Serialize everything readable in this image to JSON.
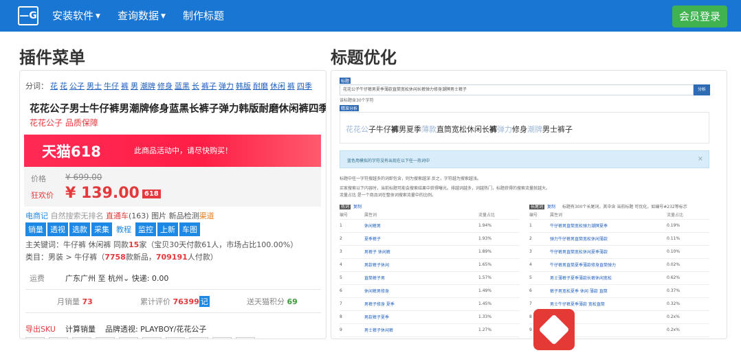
{
  "topbar": {
    "logo": "—G",
    "nav": [
      {
        "label": "安装软件",
        "caret": true
      },
      {
        "label": "查询数据",
        "caret": true
      },
      {
        "label": "制作标题",
        "caret": false
      }
    ],
    "member_button": "会员登录"
  },
  "left_section": {
    "title": "插件菜单",
    "tags_label": "分词：",
    "tags": [
      "花",
      "花",
      "公子",
      "男士",
      "牛仔",
      "裤",
      "男",
      "潮牌",
      "修身",
      "蓝黑",
      "长",
      "裤子",
      "弹力",
      "韩版",
      "耐磨",
      "休闲",
      "裤",
      "四季"
    ],
    "product_title": "花花公子男士牛仔裤男潮牌修身蓝黑长裤子弹力韩版耐磨休闲裤四季",
    "product_sub": "花花公子 品质保障",
    "banner": {
      "logo": "天猫618",
      "text": "此商品活动中，请尽快购买！"
    },
    "price": {
      "label_orig": "价格",
      "orig": "¥ 699.00",
      "label_sale": "狂欢价",
      "sale": "¥ 139.00",
      "badge": "618"
    },
    "line1": {
      "shop": "电商记",
      "text1": "自然搜索无排名",
      "ztc": "直通车",
      "ztc_count": "(163)",
      "pic": "图片",
      "detect": "新品检测",
      "channel": "渠道"
    },
    "buttons": [
      "销量",
      "透视",
      "选款",
      "采集",
      "教程",
      "监控",
      "上新",
      "车图"
    ],
    "keywords_line": {
      "label": "主关键词：",
      "kw": "牛仔裤 休闲裤",
      "same_label": "同款",
      "same_count": "15",
      "same_unit": "家",
      "detail": "（宝贝30天付款61人，市场占比100.00%）"
    },
    "category_line": {
      "label": "类目：",
      "path": "男装 > 牛仔裤",
      "new_count": "7758",
      "new_label": "款新品，",
      "buyers": "709191",
      "buyers_label": "人付款）"
    },
    "shipping": {
      "label": "运费",
      "from": "广东广州",
      "to_word": "至",
      "to": "杭州",
      "express": "快递: 0.00"
    },
    "stats": [
      {
        "label": "月销量",
        "value": "73"
      },
      {
        "label": "累计评价",
        "value": "76399",
        "tag": "记"
      },
      {
        "label": "送天猫积分",
        "value": "69"
      }
    ],
    "footer": [
      "导出SKU",
      "计算销量",
      "品牌透视: PLAYBOY/花花公子"
    ]
  },
  "right_section": {
    "title": "标题优化",
    "tag_title": "标题",
    "input_value": "花花公子牛仔裤男夏季薄款直筒宽松休闲长裤弹力修身潮牌男士裤子",
    "analyze_button": "分析",
    "char_count_note": "该标题含30个字符",
    "tag_optimized": "精准分析",
    "optimized": [
      {
        "t": "花花公",
        "gray": true
      },
      {
        "t": "子牛仔",
        "gray": false
      },
      {
        "t": "裤",
        "gray": false,
        "bold": true
      },
      {
        "t": "男夏季",
        "gray": false
      },
      {
        "t": "薄款",
        "gray": true
      },
      {
        "t": "直筒宽松休闲长",
        "gray": false
      },
      {
        "t": "裤",
        "gray": false,
        "bold": true
      },
      {
        "t": "弹力",
        "gray": true
      },
      {
        "t": "修身",
        "gray": false
      },
      {
        "t": "潮牌",
        "gray": true
      },
      {
        "t": "男士裤子",
        "gray": false
      }
    ],
    "alert": "蓝色用模拟的字符没有出现在以下任一热词中",
    "notes": [
      "标题中任一字符搜越多的词即包含，则为搜索越深 反之，字符越为搜索越浅。",
      "买家搜索以下内容时，当前标题可能会搜索结果中获得曝光。排越词越多，词越热门，标题获得的搜索流量就越大。",
      "流量占比 是一个商品词在整体词搜索流量中的比例。"
    ],
    "left_table": {
      "label": "热词",
      "copy": "复制",
      "headers": [
        "编号",
        "属性词",
        "流量占比"
      ],
      "rows": [
        [
          "1",
          "休闲裤男",
          "1.94%"
        ],
        [
          "2",
          "夏季裤子",
          "1.93%"
        ],
        [
          "3",
          "男裤子 休闲裤",
          "1.89%"
        ],
        [
          "4",
          "男款裤子休闲",
          "1.65%"
        ],
        [
          "5",
          "直筒裤子男",
          "1.57%"
        ],
        [
          "6",
          "休闲裤男修身",
          "1.49%"
        ],
        [
          "7",
          "男裤子修身 夏季",
          "1.45%"
        ],
        [
          "8",
          "男款裤子夏季",
          "1.33%"
        ],
        [
          "9",
          "男士裤子休闲裤",
          "1.27%"
        ]
      ]
    },
    "right_table": {
      "label": "长尾词",
      "copy": "复制",
      "note": "标题有300个长尾词，其中含 当前标题 可优化，如编号#232等标示",
      "headers": [
        "编号",
        "属性词",
        "流量占比"
      ],
      "rows": [
        [
          "1",
          "牛仔裤男直筒宽松弹力潮牌夏季",
          "0.19%"
        ],
        [
          "2",
          "弹力牛仔裤男直筒宽松休闲薄款",
          "0.11%"
        ],
        [
          "3",
          "牛仔裤男直筒宽松休闲夏季薄款",
          "0.10%"
        ],
        [
          "4",
          "牛仔裤男直筒夏季薄款修身直筒弹力",
          "0.02%"
        ],
        [
          "5",
          "男士薄裤子夏季薄款长裤休闲宽松",
          "0.62%"
        ],
        [
          "6",
          "裤子男宽松夏季 休闲 薄款 直筒",
          "0.37%"
        ],
        [
          "7",
          "男士牛仔裤夏季薄款 宽松直筒",
          "0.32%"
        ],
        [
          "8",
          "",
          "0.2x%"
        ],
        [
          "9",
          "",
          "0.2x%"
        ]
      ]
    }
  }
}
